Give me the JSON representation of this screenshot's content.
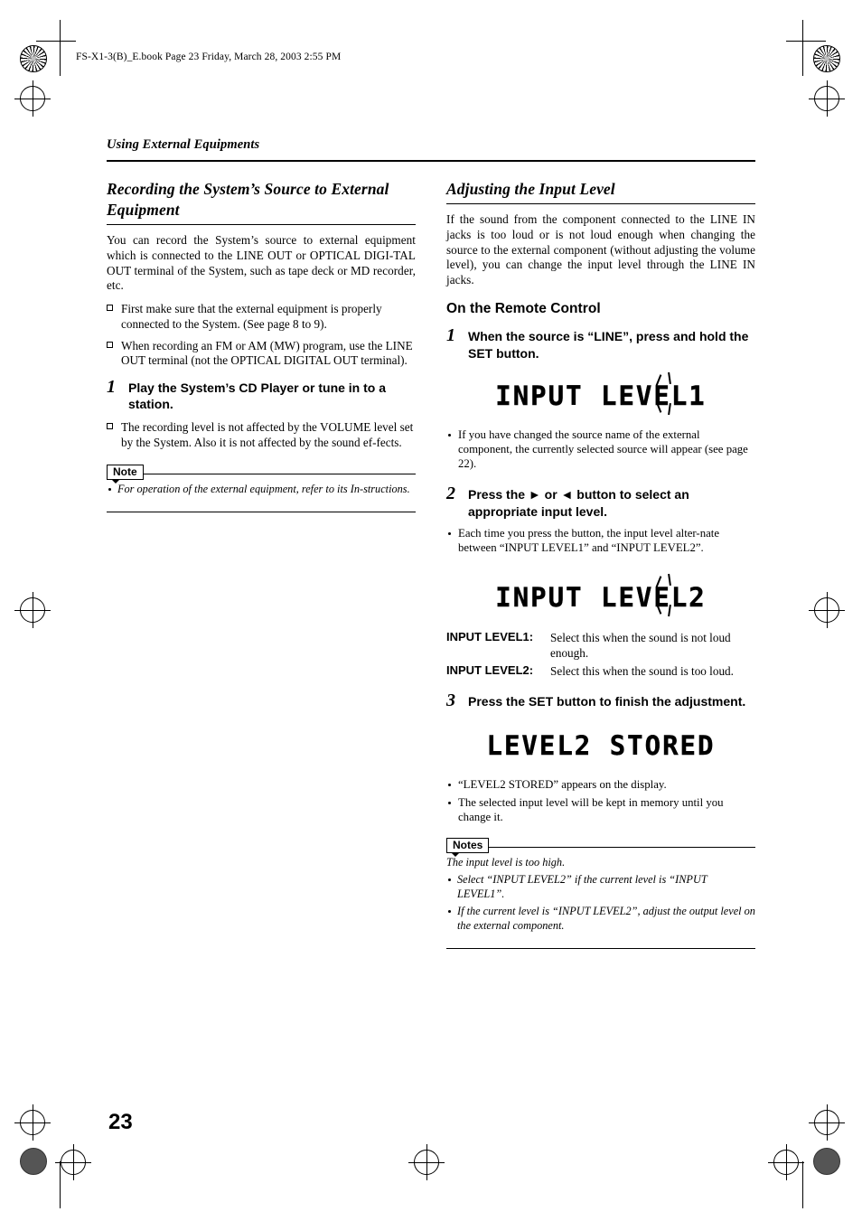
{
  "header": {
    "filestamp": "FS-X1-3(B)_E.book  Page 23  Friday, March 28, 2003  2:55 PM"
  },
  "running_head": "Using External Equipments",
  "page_number": "23",
  "left_column": {
    "section_title": "Recording the System’s Source to External Equipment",
    "intro": "You can record the System’s source to external equipment which is connected to the LINE OUT or OPTICAL DIGI-TAL OUT terminal of the System, such as tape deck or MD recorder, etc.",
    "bullets": [
      "First make sure that the external equipment is properly connected to the System. (See page 8 to 9).",
      "When recording an FM or AM (MW) program, use the LINE OUT terminal (not the OPTICAL DIGITAL OUT terminal)."
    ],
    "step1": {
      "number": "1",
      "text": "Play the System’s CD Player or tune in to a station."
    },
    "step1_bullets": [
      "The recording level is not affected by the VOLUME level set by the System. Also it is not affected by the sound ef-fects."
    ],
    "note": {
      "tag": "Note",
      "items": [
        "For operation of the external equipment, refer to its In-structions."
      ]
    }
  },
  "right_column": {
    "section_title": "Adjusting the Input Level",
    "intro": "If the sound from the component connected to the LINE IN jacks is too loud or is not loud enough when changing the source to the external component (without adjusting the volume level), you can change the input level through the LINE IN jacks.",
    "subhead": "On the Remote Control",
    "step1": {
      "number": "1",
      "text": "When the source is “LINE”, press and hold the SET button."
    },
    "display1": "INPUT LEVEL1",
    "step1_bullets": [
      "If you have changed the source name of the external component, the currently selected source will appear (see page 22)."
    ],
    "step2": {
      "number": "2",
      "text": "Press the ► or ◄ button to select an appropriate input level."
    },
    "step2_bullets": [
      "Each time you press the button, the input level alter-nate between “INPUT LEVEL1” and “INPUT LEVEL2”."
    ],
    "display2": "INPUT LEVEL2",
    "definitions": [
      {
        "term": "INPUT LEVEL1:",
        "desc": "Select this when the sound is not loud enough."
      },
      {
        "term": "INPUT LEVEL2:",
        "desc": "Select this when the sound is too loud."
      }
    ],
    "step3": {
      "number": "3",
      "text": "Press the SET button to finish the adjustment."
    },
    "display3": "LEVEL2 STORED",
    "step3_bullets": [
      "“LEVEL2 STORED” appears on the display.",
      "The selected input level will be kept in memory until you change it."
    ],
    "notes": {
      "tag": "Notes",
      "lead": "The input level is too high.",
      "items": [
        "Select “INPUT LEVEL2” if the current level is “INPUT LEVEL1”.",
        "If the current level is “INPUT LEVEL2”, adjust the output level on the external component."
      ]
    }
  }
}
